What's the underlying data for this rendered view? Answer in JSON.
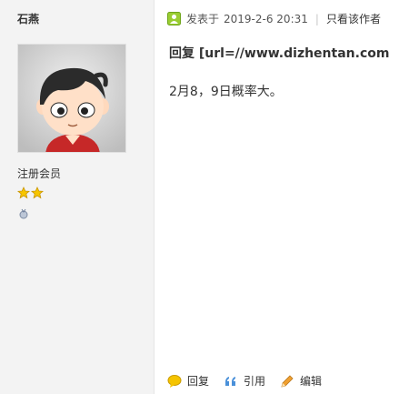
{
  "author": {
    "name": "石燕",
    "group": "注册会员"
  },
  "post": {
    "meta_prefix": "发表于",
    "timestamp": "2019-2-6 20:31",
    "separator": "|",
    "only_author_label": "只看该作者",
    "reply_title": "回复 [url=//www.dizhentan.com",
    "body": "2月8，9日概率大。"
  },
  "actions": {
    "reply_label": "回复",
    "quote_label": "引用",
    "edit_label": "编辑"
  },
  "colors": {
    "sidebar_bg": "#f3f3f3",
    "online_icon": "#9acd32",
    "reply_icon": "#f5c400",
    "quote_icon": "#4a90d9",
    "edit_icon": "#f0a030"
  }
}
